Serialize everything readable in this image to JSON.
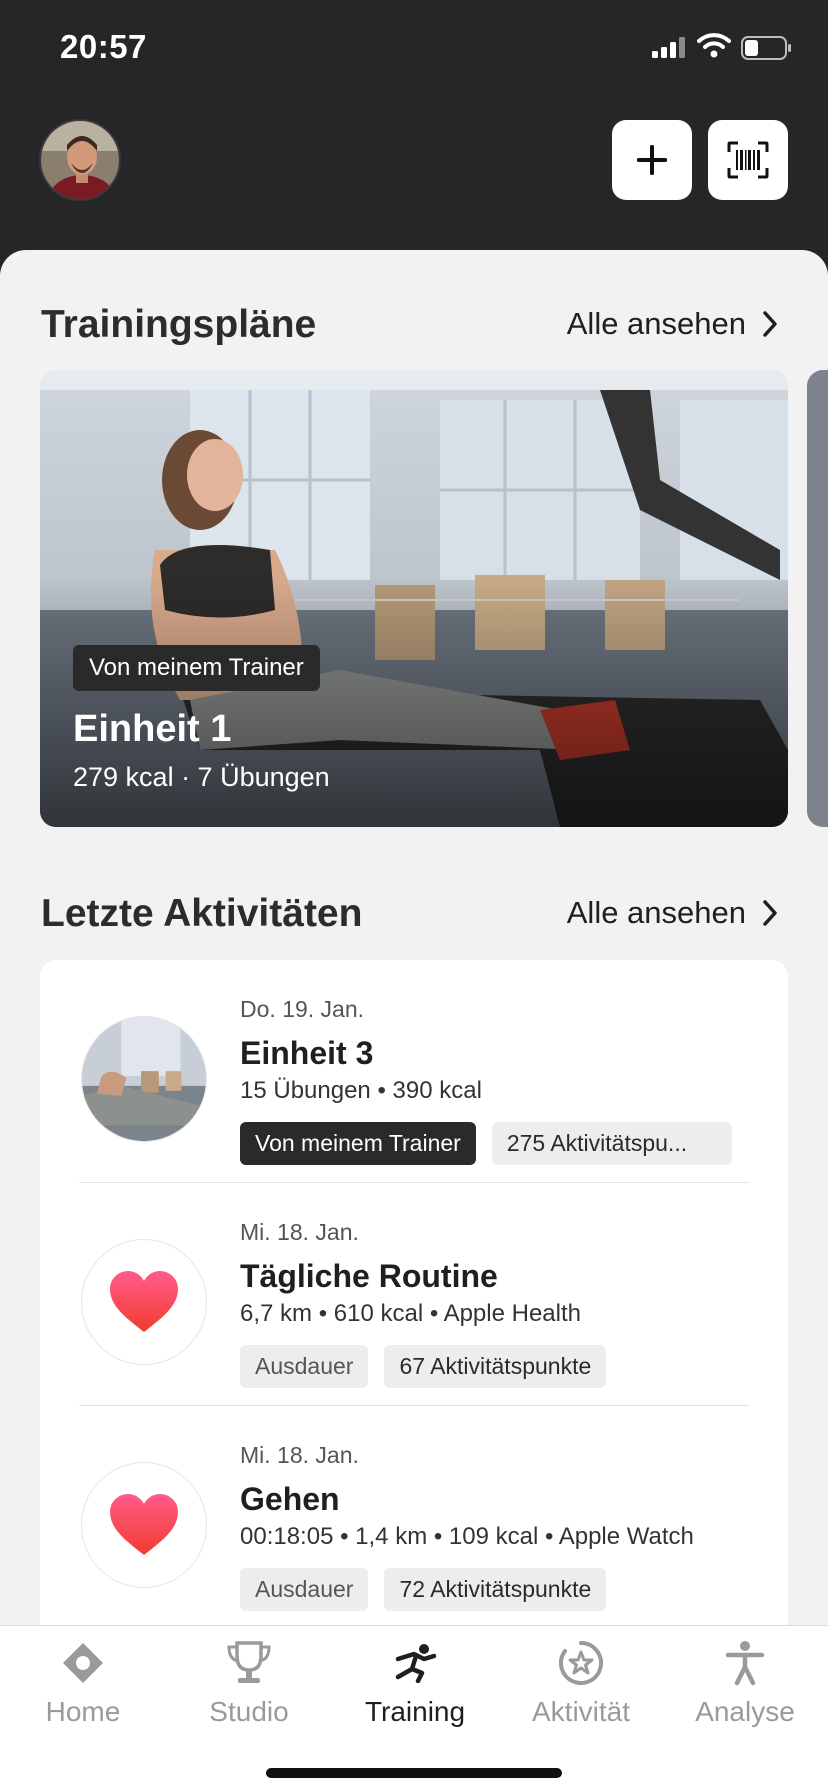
{
  "status": {
    "time": "20:57"
  },
  "plans": {
    "title": "Trainingspläne",
    "see_all": "Alle ansehen",
    "card": {
      "badge": "Von meinem Trainer",
      "title": "Einheit 1",
      "meta": "279 kcal · 7 Übungen"
    }
  },
  "activities": {
    "title": "Letzte Aktivitäten",
    "see_all": "Alle ansehen",
    "items": [
      {
        "date": "Do. 19. Jan.",
        "title": "Einheit 3",
        "meta": "15 Übungen • 390 kcal",
        "tags": [
          "Von meinem Trainer",
          "275 Aktivitätspu..."
        ],
        "icon": "workout-photo"
      },
      {
        "date": "Mi. 18. Jan.",
        "title": "Tägliche Routine",
        "meta": "6,7 km • 610 kcal • Apple Health",
        "tags": [
          "Ausdauer",
          "67 Aktivitätspunkte"
        ],
        "icon": "heart-icon"
      },
      {
        "date": "Mi. 18. Jan.",
        "title": "Gehen",
        "meta": "00:18:05 • 1,4 km • 109 kcal • Apple Watch",
        "tags": [
          "Ausdauer",
          "72 Aktivitätspunkte"
        ],
        "icon": "heart-icon"
      }
    ]
  },
  "tabs": [
    {
      "label": "Home",
      "icon": "home-icon",
      "active": false
    },
    {
      "label": "Studio",
      "icon": "trophy-icon",
      "active": false
    },
    {
      "label": "Training",
      "icon": "training-icon",
      "active": true
    },
    {
      "label": "Aktivität",
      "icon": "activity-star-icon",
      "active": false
    },
    {
      "label": "Analyse",
      "icon": "person-icon",
      "active": false
    }
  ],
  "colors": {
    "dark_bg": "#262628",
    "sheet_bg": "#f2f2f2",
    "heart_top": "#ff5c8a",
    "heart_bottom": "#f23b2f"
  }
}
